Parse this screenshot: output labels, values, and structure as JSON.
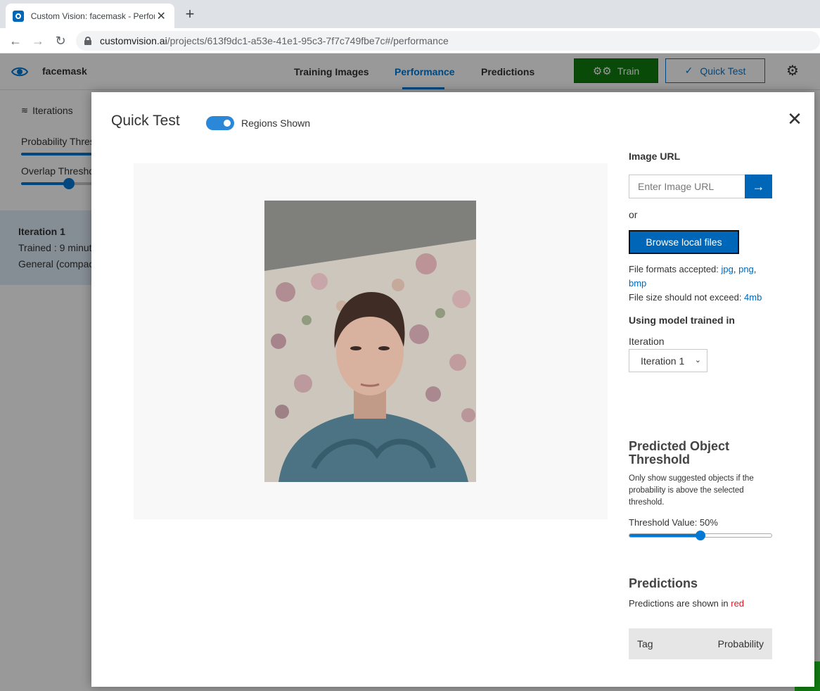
{
  "browser": {
    "tab_title": "Custom Vision: facemask - Perfor",
    "tab_close": "✕",
    "new_tab": "+",
    "back": "←",
    "forward": "→",
    "reload": "↻",
    "url_host": "customvision.ai",
    "url_path": "/projects/613f9dc1-a53e-41e1-95c3-7f7c749fbe7c#/performance"
  },
  "app": {
    "project_name": "facemask",
    "nav": [
      "Training Images",
      "Performance",
      "Predictions"
    ],
    "active_nav": "Performance",
    "train_label": "Train",
    "quick_test_label": "Quick Test",
    "accent_color": "#0078d4",
    "train_color": "#107c10"
  },
  "sidebar": {
    "iterations_label": "Iterations",
    "probability_label": "Probability Thres",
    "overlap_label": "Overlap Thresho",
    "overlap_value": 0.33,
    "iteration_name": "Iteration 1",
    "trained": "Trained : 9 minut",
    "domain": "General (compac"
  },
  "modal": {
    "title": "Quick Test",
    "toggle_label": "Regions Shown",
    "toggle_on": true,
    "close": "✕",
    "image_url_label": "Image URL",
    "image_url_placeholder": "Enter Image URL",
    "go_arrow": "→",
    "or_text": "or",
    "browse_label": "Browse local files",
    "formats_prefix": "File formats accepted: ",
    "formats_jpg": "jpg",
    "formats_png": "png",
    "formats_bmp": "bmp",
    "size_prefix": "File size should not exceed: ",
    "size_value": "4mb",
    "using_model_label": "Using model trained in",
    "iteration_label": "Iteration",
    "iteration_selected": "Iteration 1",
    "threshold_title": "Predicted Object Threshold",
    "threshold_desc": "Only show suggested objects if the probability is above the selected threshold.",
    "threshold_value_label": "Threshold Value: 50%",
    "threshold_value": 0.5,
    "predictions_title": "Predictions",
    "predictions_prefix": "Predictions are shown in ",
    "predictions_color_word": "red",
    "col_tag": "Tag",
    "col_probability": "Probability"
  }
}
